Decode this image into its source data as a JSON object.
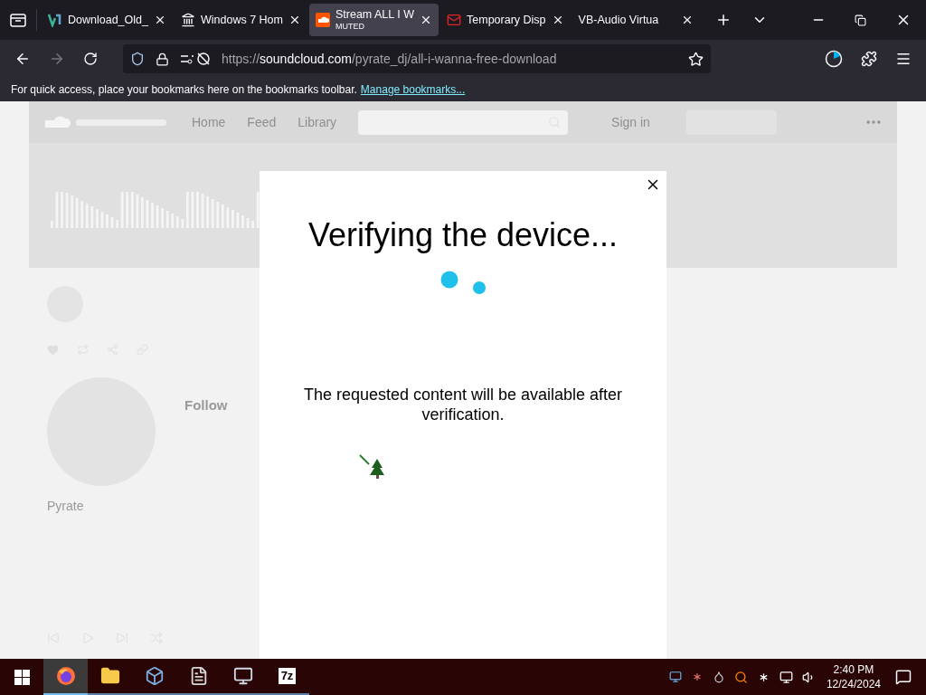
{
  "tabs": [
    {
      "label": "Download_Old_",
      "kind": "vs",
      "selected": false
    },
    {
      "label": "Windows 7 Hom",
      "kind": "building",
      "selected": false
    },
    {
      "label": "Stream ALL I W",
      "sublabel": "MUTED",
      "kind": "cloud",
      "selected": true
    },
    {
      "label": "Temporary Disp",
      "kind": "mail",
      "selected": false
    },
    {
      "label": "VB-Audio Virtua",
      "kind": "none",
      "selected": false
    }
  ],
  "address": {
    "scheme": "https://",
    "host": "soundcloud.com",
    "path": "/pyrate_dj/all-i-wanna-free-download"
  },
  "bookmarks_bar": {
    "text": "For quick access, place your bookmarks here on the bookmarks toolbar.",
    "link": "Manage bookmarks..."
  },
  "site": {
    "nav": [
      "Home",
      "Feed",
      "Library"
    ],
    "sign_in": "Sign in",
    "follow": "Follow",
    "artist": "Pyrate"
  },
  "dialog": {
    "title": "Verifying the device...",
    "message": "The requested content will be available after verification."
  },
  "taskbar": {
    "apps": [
      {
        "kind": "firefox",
        "active": true
      },
      {
        "kind": "folder",
        "active": false
      },
      {
        "kind": "cube",
        "active": false
      },
      {
        "kind": "doc",
        "active": false
      },
      {
        "kind": "monitor",
        "active": false
      },
      {
        "kind": "sevenzip",
        "label": "7z",
        "active": false
      }
    ],
    "time": "2:40 PM",
    "date": "12/24/2024"
  }
}
